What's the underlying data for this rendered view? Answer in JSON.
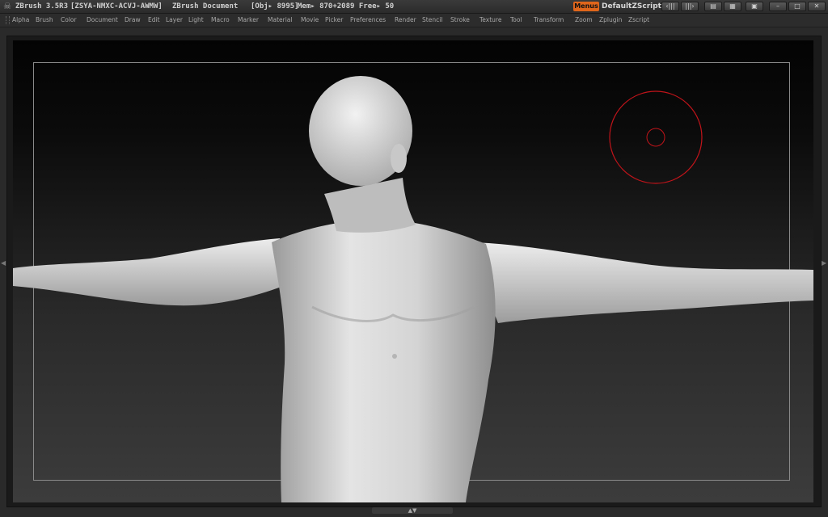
{
  "window": {
    "app_title": "ZBrush 3.5R3",
    "license_id": "[ZSYA-NMXC-ACVJ-AWMW]",
    "document_name": "ZBrush Document",
    "obj_readout": "[Obj▸ 8995]",
    "mem_readout": "Mem▸ 870+2089 Free▸ 50"
  },
  "titlebar_controls": {
    "menus_label": "Menus",
    "script_label": "DefaultZScript",
    "icons": [
      "slider-left-icon",
      "slider-right-icon",
      "layout-icon",
      "layout-alt-icon",
      "lock-icon",
      "minimize-icon",
      "restore-icon",
      "close-icon"
    ]
  },
  "menu": {
    "items": [
      "Alpha",
      "Brush",
      "Color",
      "Document",
      "Draw",
      "Edit",
      "Layer",
      "Light",
      "Macro",
      "Marker",
      "Material",
      "Movie",
      "Picker",
      "Preferences",
      "Render",
      "Stencil",
      "Stroke",
      "Texture",
      "Tool",
      "Transform",
      "Zoom",
      "Zplugin",
      "Zscript"
    ]
  },
  "canvas": {
    "brush_cursor_color": "#c0141a",
    "background_color": "#0a0a0a",
    "model_color": "#d8d8d8"
  }
}
